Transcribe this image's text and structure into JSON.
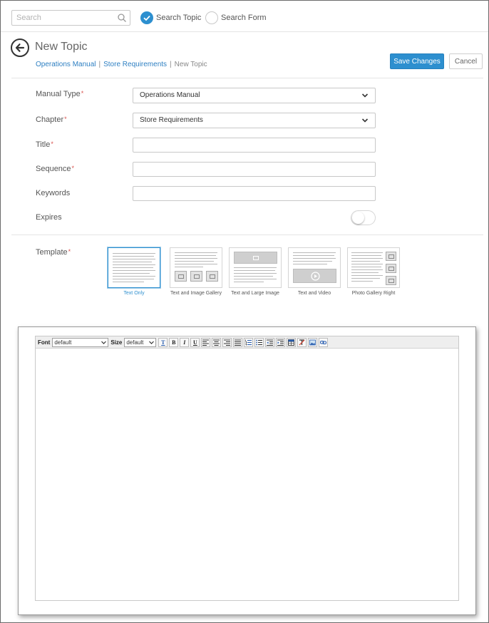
{
  "search": {
    "placeholder": "Search"
  },
  "search_mode": {
    "options": [
      "Search Topic",
      "Search Form"
    ],
    "selected": "Search Topic"
  },
  "header": {
    "title": "New Topic",
    "breadcrumb": [
      "Operations Manual",
      "Store Requirements",
      "New Topic"
    ],
    "save_label": "Save Changes",
    "cancel_label": "Cancel"
  },
  "form": {
    "manual_type": {
      "label": "Manual Type",
      "required_mark": "*",
      "value": "Operations Manual"
    },
    "chapter": {
      "label": "Chapter",
      "required_mark": "*",
      "value": "Store Requirements"
    },
    "title": {
      "label": "Title",
      "required_mark": "*",
      "value": ""
    },
    "sequence": {
      "label": "Sequence",
      "required_mark": "*",
      "value": ""
    },
    "keywords": {
      "label": "Keywords",
      "value": ""
    },
    "expires": {
      "label": "Expires",
      "enabled": false
    }
  },
  "template": {
    "label": "Template",
    "required_mark": "*",
    "selected": "Text Only",
    "options": [
      "Text Only",
      "Text and Image Gallery",
      "Text and Large Image",
      "Text and Video",
      "Photo Gallery Right"
    ]
  },
  "editor": {
    "font_label": "Font",
    "font_value": "default",
    "size_label": "Size",
    "size_value": "default",
    "buttons": [
      "T",
      "B",
      "I",
      "U"
    ]
  },
  "colors": {
    "accent": "#2d8fcf",
    "link": "#2d7fc2",
    "required": "#d9534f"
  }
}
